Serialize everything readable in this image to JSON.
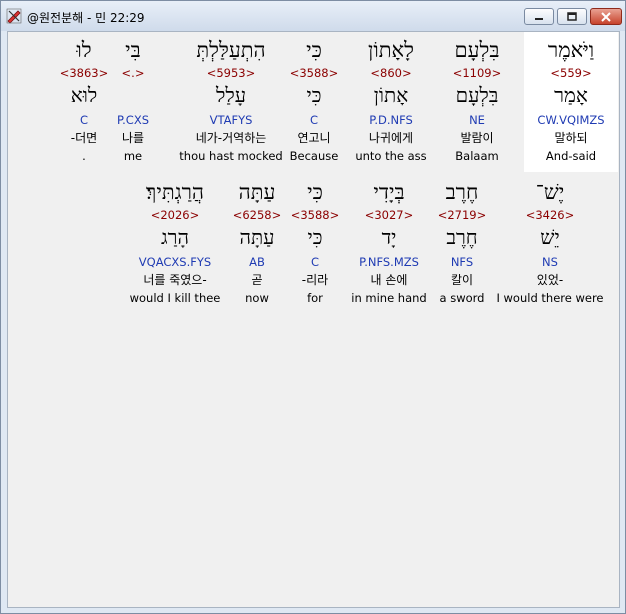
{
  "window": {
    "title": "@원전분해 - 민 22:29",
    "accent": "#c7432c"
  },
  "verse_rows": [
    [
      {
        "heb": "וַיֹּאמֶר",
        "strong": "<559>",
        "lex": "אָמַר",
        "morph": "CW.VQIMZS",
        "kor": "말하되",
        "eng": "And-said"
      },
      {
        "heb": "בִּלְעָם",
        "strong": "<1109>",
        "lex": "בִּלְעָם",
        "morph": "NE",
        "kor": "발람이",
        "eng": "Balaam"
      },
      {
        "heb": "לָאָתוֹן",
        "strong": "<860>",
        "lex": "אָתוֹן",
        "morph": "P.D.NFS",
        "kor": "나귀에게",
        "eng": "unto the ass"
      },
      {
        "heb": "כִּי",
        "strong": "<3588>",
        "lex": "כִּי",
        "morph": "C",
        "kor": "연고니",
        "eng": "Because"
      },
      {
        "heb": "הִתְעַלַּלְתְּ",
        "strong": "<5953>",
        "lex": "עָלַל",
        "morph": "VTAFYS",
        "kor": "네가-거역하는",
        "eng": "thou hast mocked"
      },
      {
        "heb": "בִּי",
        "strong": "<.>",
        "lex": "",
        "morph": "P.CXS",
        "kor": "나를",
        "eng": "me"
      },
      {
        "heb": "לוּ",
        "strong": "<3863>",
        "lex": "לוּא",
        "morph": "C",
        "kor": "-더면",
        "eng": "."
      }
    ],
    [
      {
        "heb": "יֶשׁ־",
        "strong": "<3426>",
        "lex": "יֵשׁ",
        "morph": "NS",
        "kor": "있었-",
        "eng": "I would there were"
      },
      {
        "heb": "חֶרֶב",
        "strong": "<2719>",
        "lex": "חֶרֶב",
        "morph": "NFS",
        "kor": "칼이",
        "eng": "a sword"
      },
      {
        "heb": "בְּיָדִי",
        "strong": "<3027>",
        "lex": "יָד",
        "morph": "P.NFS.MZS",
        "kor": "내 손에",
        "eng": "in mine hand"
      },
      {
        "heb": "כִּי",
        "strong": "<3588>",
        "lex": "כִּי",
        "morph": "C",
        "kor": "-리라",
        "eng": "for"
      },
      {
        "heb": "עַתָּה",
        "strong": "<6258>",
        "lex": "עַתָּה",
        "morph": "AB",
        "kor": "곧",
        "eng": "now"
      },
      {
        "heb": "הֲרַגְתִּיךְ׃",
        "strong": "<2026>",
        "lex": "הָרַג",
        "morph": "VQACXS.FYS",
        "kor": "너를 죽였으-",
        "eng": "would I kill thee"
      }
    ]
  ]
}
